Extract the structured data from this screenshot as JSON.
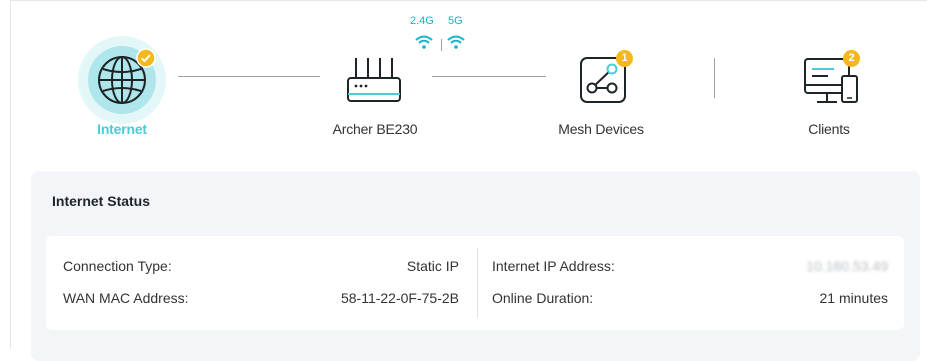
{
  "topology": {
    "internet": {
      "label": "Internet",
      "status": "connected"
    },
    "router": {
      "label": "Archer BE230",
      "bands": [
        "2.4G",
        "5G"
      ]
    },
    "mesh": {
      "label": "Mesh Devices",
      "count": "1"
    },
    "clients": {
      "label": "Clients",
      "count": "2"
    }
  },
  "internet_status": {
    "title": "Internet Status",
    "connection_type_label": "Connection Type:",
    "connection_type_value": "Static IP",
    "wan_mac_label": "WAN MAC Address:",
    "wan_mac_value": "58-11-22-0F-75-2B",
    "ip_label": "Internet IP Address:",
    "ip_value": "10.160.53.49",
    "duration_label": "Online Duration:",
    "duration_value": "21 minutes"
  },
  "colors": {
    "accent": "#4acbd6",
    "badge": "#f5b81c",
    "wifi": "#1ab0c8",
    "panel": "#f3f5f8"
  }
}
